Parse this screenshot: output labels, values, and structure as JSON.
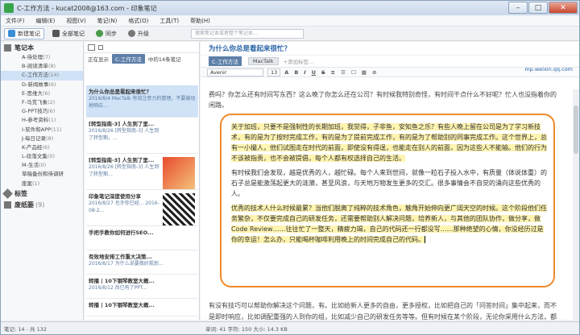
{
  "window": {
    "title": "C-工作方法 - kucat2008@163.com - 印象笔记",
    "btn_min": "–",
    "btn_max": "□",
    "btn_close": "✕"
  },
  "menu": [
    "文件(F)",
    "编辑(E)",
    "视图(V)",
    "笔记(N)",
    "格式(O)",
    "工具(T)",
    "帮助(H)"
  ],
  "toolbar": {
    "new_note": "新建笔记",
    "all_notes": "全部笔记",
    "sync": "同步",
    "upgrade": "升级",
    "search_placeholder": "搜索笔记本或者整个笔记本..."
  },
  "sidebar": {
    "notebooks_label": "笔记本",
    "items": [
      {
        "label": "A-待处理",
        "count": "(7)"
      },
      {
        "label": "B-阅读清单",
        "count": "(8)"
      },
      {
        "label": "C-工作方法",
        "count": "(14)"
      },
      {
        "label": "D-新闻故事",
        "count": "(6)"
      },
      {
        "label": "E-思维大",
        "count": "(6)"
      },
      {
        "label": "F-马克飞象",
        "count": "(2)"
      },
      {
        "label": "G-PPT技巧",
        "count": "(6)"
      },
      {
        "label": "H-参考资料",
        "count": "(1)"
      },
      {
        "label": "I-软件和APP",
        "count": "(11)"
      },
      {
        "label": "J-每日记录",
        "count": "(8)"
      },
      {
        "label": "K-产品经",
        "count": "(6)"
      },
      {
        "label": "L-段落文集",
        "count": "(0)"
      },
      {
        "label": "M-生活",
        "count": "(0)"
      },
      {
        "label": "草稿备份和待调研",
        "count": ""
      },
      {
        "label": "废案",
        "count": "(1)"
      }
    ],
    "tags_label": "标签",
    "trash_label": "废纸篓",
    "trash_count": "(9)"
  },
  "notelist": {
    "filter_prefix": "正在显示",
    "filter_chip": "C-工作方法",
    "filter_suffix": "中的14条笔记",
    "notes": [
      {
        "title": "为什么你总是看起来很忙？",
        "date": "2016/8/4",
        "snip": "MacTalk 有效注意力的管理，不要被动地响应..."
      },
      {
        "title": "[转型指南-3] 人生到了里...",
        "date": "2016/8/26",
        "snip": "[转型指南-3] 人生到了转型期，..."
      },
      {
        "title": "[转型指南-3] 人生到了里...",
        "date": "2016/8/26",
        "snip": "[转型指南-3] 人生到了转型期..."
      },
      {
        "title": "印象笔记深度使用分享",
        "date": "2016/8/27",
        "snip": "也许你已经... 2016-08-2..."
      },
      {
        "title": "手把手教你如何进行SEO...",
        "date": "",
        "snip": ""
      },
      {
        "title": "有效地安排工作重大决策...",
        "date": "2016/8/17",
        "snip": "为什么说要做好规划..."
      },
      {
        "title": "转播 | 10下钢琴教室大概...",
        "date": "2016/8/12",
        "snip": "尚已有了PPT..."
      },
      {
        "title": "转播 | 10下钢琴教室大概...",
        "date": "",
        "snip": ""
      }
    ]
  },
  "editor": {
    "title": "为什么你总是看起来很忙？",
    "notebook_chip": "C-工作方法",
    "tag": "MacTalk",
    "tag_placeholder": "+添加标签...",
    "source_url": "mp.weixin.qq.com",
    "font_name": "Avenir",
    "font_size": "13",
    "intro": "费吗？你怎么还有时间写东西？这么晚了你怎么还在公司？有时候我特别奇怪，有时间干点什么不好呢？忙人也没指着你的闲路。",
    "outro": "有没有技巧可以帮助你解决这个问题，有。比如给新人更多的自由，更多授权，比如把自己的「问答时间」集中起来，而不是即时响应，比如调配重强的人到你的组，比如减少自己的研发任务等等。但有时候在某个阶段，无论你采用什么方法，都无法缓解你的忙碌和疲惫，因为事情就"
  },
  "callout": {
    "p1": "关于加班，只要不是强制性的长期加班，我觉得，子非鱼，安知鱼之乐？有些人晚上留在公司是为了学习新技术，有的是为了按时完成工作，有的是为了提前完成工作，有的是为了帮助别的同事完成工作。这个世界上，总有一小撮人，他们试图走在时代的前面，即使没有得逞，也能走在别人的前面，因为这些人不能输。他们的行为不该被指责，也不会被提倡，每个人都有权选择自己的生活。",
    "p2": "有时候我们会发现，越是优秀的人，越忙碌。每个人来到世间，就像一粒石子投入水中，有质量（体说体重）的石子总是能激荡起更大的涟漪，甚至风浪，与天地万物发生更多的交汇。很多事情会不自觉的涌向这些优秀的人。",
    "p3": "优秀的技术人什么时候最累？当他们脱离了纯粹的技术角色，触角开始伸向更广阔天空的时候。这个阶段他们任务繁杂，不仅要完成自己的研发任务，还需要帮助别人解决问题，培养新人，与其他的团队协作，做分享，做 Code Review……往往忙了一整天，精疲力竭，自己的代码还一行都没写……那种绝望的心情，你没经历过是你的幸运！怎么办，只能喝杯咖啡利用晚上的时间完成自己的代码。"
  },
  "status": {
    "left": "笔记: 14 - 共 132",
    "right": "单词: 41   字符: 150   大小: 14.3 KB"
  },
  "colors": {
    "accent": "#2a64a8",
    "callout_border": "#f08a2c",
    "highlight": "#fff4b0",
    "chip": "#5d7fa8"
  }
}
